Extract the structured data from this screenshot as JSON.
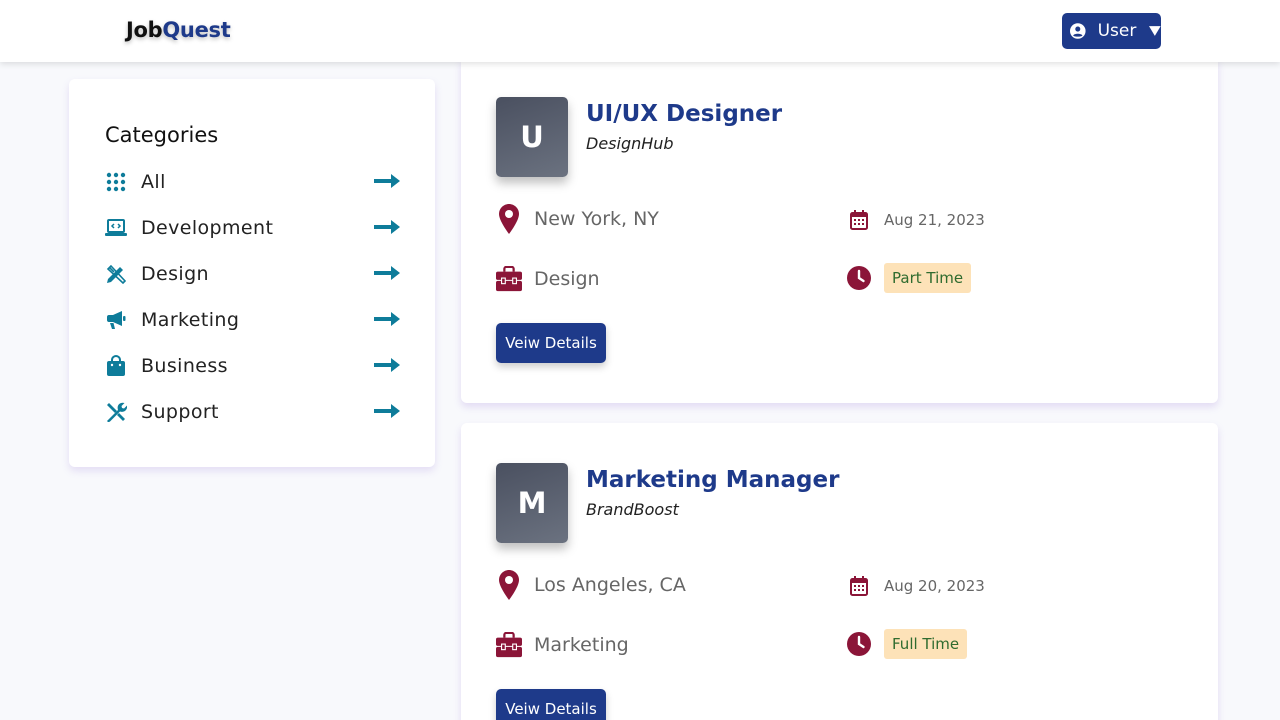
{
  "header": {
    "logo_part1": "Job",
    "logo_part2": "Quest",
    "user_label": "User"
  },
  "sidebar": {
    "title": "Categories",
    "items": [
      {
        "label": "All",
        "icon": "grid-icon"
      },
      {
        "label": "Development",
        "icon": "laptop-code-icon"
      },
      {
        "label": "Design",
        "icon": "pencil-ruler-icon"
      },
      {
        "label": "Marketing",
        "icon": "megaphone-icon"
      },
      {
        "label": "Business",
        "icon": "shopping-bag-icon"
      },
      {
        "label": "Support",
        "icon": "tools-icon"
      }
    ]
  },
  "jobs": [
    {
      "initial": "U",
      "title": "UI/UX Designer",
      "company": "DesignHub",
      "location": "New York, NY",
      "date": "Aug 21, 2023",
      "category": "Design",
      "type": "Part Time",
      "button": "Veiw Details"
    },
    {
      "initial": "M",
      "title": "Marketing Manager",
      "company": "BrandBoost",
      "location": "Los Angeles, CA",
      "date": "Aug 20, 2023",
      "category": "Marketing",
      "type": "Full Time",
      "button": "Veiw Details"
    }
  ],
  "colors": {
    "brand": "#1e3a8a",
    "accent_teal": "#0e7c9a",
    "icon_maroon": "#8b1538",
    "badge_bg": "#fde2b8",
    "badge_text": "#2f6b2f"
  }
}
